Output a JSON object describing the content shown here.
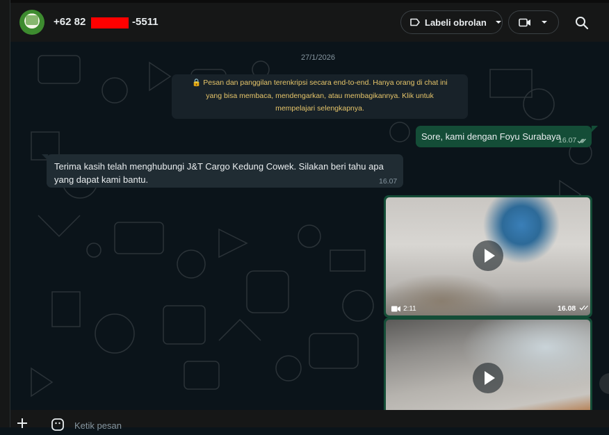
{
  "header": {
    "contact_name": "+62 82        -5511",
    "labels_button": "Labeli obrolan"
  },
  "chat": {
    "date_chip": "27/1/2026",
    "encryption_notice": {
      "line1": "Pesan dan panggilan terenkripsi secara end-to-end. Hanya orang di chat ini",
      "line2": "yang bisa membaca, mendengarkan, atau membagikannya. Klik untuk",
      "line3": "mempelajari selengkapnya."
    },
    "messages": [
      {
        "direction": "outgoing",
        "text": "Sore, kami dengan Foyu Surabaya",
        "time": "16.07",
        "status": "read"
      },
      {
        "direction": "incoming",
        "text": "Terima kasih telah menghubungi J&T Cargo Kedung Cowek. Silakan beri tahu apa yang dapat kami bantu.",
        "time": "16.07"
      },
      {
        "direction": "outgoing",
        "type": "video",
        "duration": "2:11",
        "time": "16.08",
        "status": "read"
      },
      {
        "direction": "outgoing",
        "type": "video"
      }
    ]
  },
  "compose": {
    "placeholder": "Ketik pesan"
  },
  "colors": {
    "outgoing_bubble": "#144d37",
    "incoming_bubble": "#202c33",
    "notice_text": "#e6c56a",
    "background": "#0b141a"
  },
  "icons": [
    "label-icon",
    "chevron-down-icon",
    "video-call-icon",
    "search-icon",
    "lock-icon",
    "double-check-icon",
    "play-icon",
    "video-camera-icon",
    "plus-icon",
    "emoji-icon"
  ]
}
